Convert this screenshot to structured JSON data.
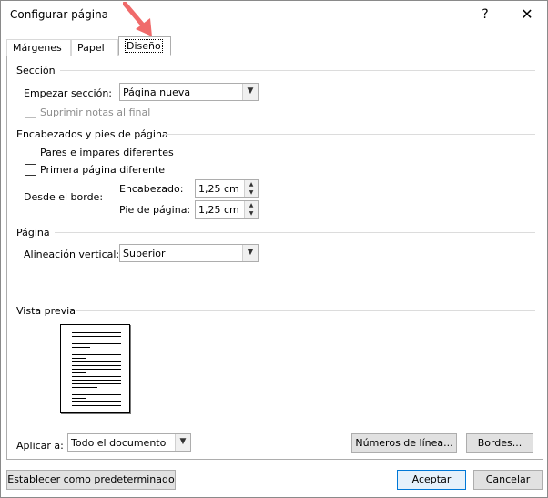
{
  "window": {
    "title": "Configurar página",
    "help": "?",
    "close": "✕"
  },
  "tabs": [
    {
      "label": "Márgenes"
    },
    {
      "label": "Papel"
    },
    {
      "label": "Diseño"
    }
  ],
  "section": {
    "title": "Sección",
    "start_label": "Empezar sección:",
    "start_value": "Página nueva",
    "suppress_endnotes": "Suprimir notas al final"
  },
  "headers_footers": {
    "title": "Encabezados y pies de página",
    "odd_even": "Pares e impares diferentes",
    "first_page": "Primera página diferente",
    "from_edge": "Desde el borde:",
    "header_label": "Encabezado:",
    "header_value": "1,25 cm",
    "footer_label": "Pie de página:",
    "footer_value": "1,25 cm"
  },
  "page": {
    "title": "Página",
    "valign_label": "Alineación vertical:",
    "valign_value": "Superior"
  },
  "preview": {
    "title": "Vista previa"
  },
  "apply": {
    "label": "Aplicar a:",
    "value": "Todo el documento"
  },
  "buttons": {
    "line_numbers": "Números de línea...",
    "borders": "Bordes...",
    "set_default": "Establecer como predeterminado",
    "ok": "Aceptar",
    "cancel": "Cancelar"
  },
  "colors": {
    "annotation_arrow": "#f06b6b",
    "primary_border": "#0078d7"
  }
}
